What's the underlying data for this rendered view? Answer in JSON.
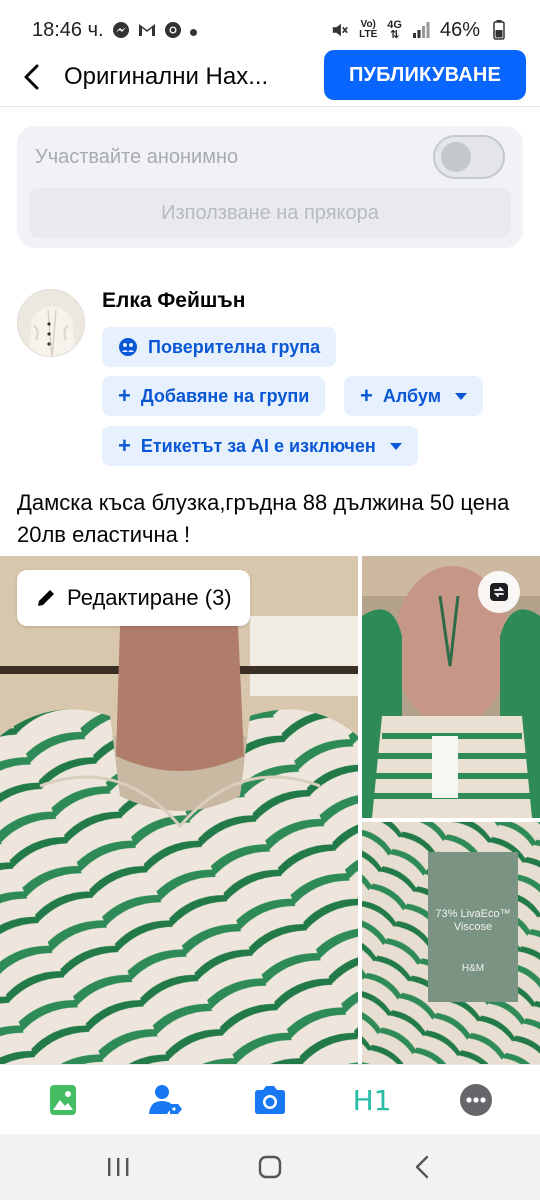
{
  "status_bar": {
    "time": "18:46 ч.",
    "battery": "46%",
    "network_top": "Vo)",
    "network_bottom": "LTE",
    "signal_type": "4G",
    "icons": [
      "messenger-icon",
      "gmail-icon",
      "chrome-icon",
      "dot-icon",
      "mute-icon",
      "wifi-icon",
      "signal-icon",
      "battery-icon"
    ]
  },
  "header": {
    "title": "Оригинални Нах...",
    "publish_label": "ПУБЛИКУВАНЕ"
  },
  "anonymous": {
    "label": "Участвайте анонимно",
    "toggle_on": false,
    "alias_button": "Използване на прякора"
  },
  "author": {
    "name": "Елка Фейшън"
  },
  "chips": {
    "privacy": "Поверителна група",
    "add_groups": "Добавяне на групи",
    "album": "Албум",
    "ai_label": "Етикетът за AI е изключен"
  },
  "post": {
    "text": "Дамска къса блузка,гръдна 88 дължина 50 цена 20лв еластична !"
  },
  "media": {
    "edit_label": "Редактиране (3)",
    "tag_text": "73% LivaEco™ Viscose",
    "tag_brand": "H&M"
  },
  "toolbar": {
    "items": [
      "photo-icon",
      "tag-people-icon",
      "camera-icon",
      "heading-icon",
      "more-icon"
    ],
    "heading_label": "H1"
  },
  "colors": {
    "brand_blue": "#0866ff",
    "chip_bg": "#e7f0fd",
    "chip_text": "#0a57d6",
    "photo_icon_green": "#45bd62",
    "heading_teal": "#2abba7"
  }
}
